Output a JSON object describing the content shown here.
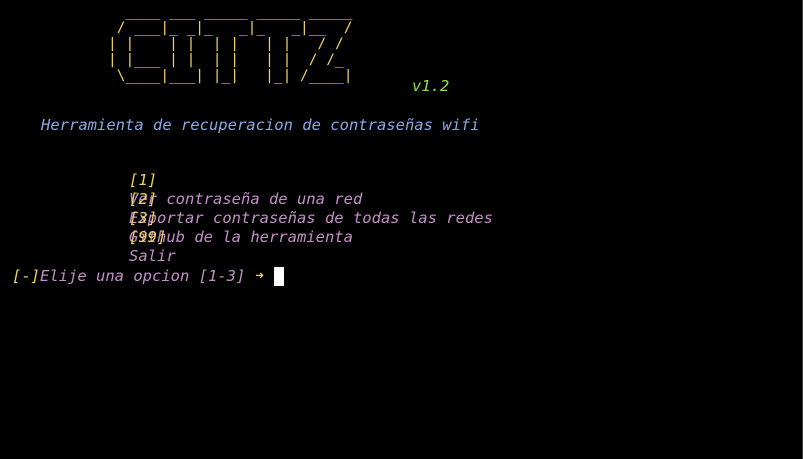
{
  "banner": {
    "ascii_art": "  ____ ___ _____ _____ _____\n / ___|_ _|_   _|_   _|__  /\n| |    | |  | |   | |   / / \n| |___ | |  | |   | |  / /_ \n \\____|___| |_|   |_| /____|",
    "version": "v1.2"
  },
  "subtitle": "Herramienta de recuperacion de contraseñas wifi",
  "menu": [
    {
      "key": "[1]",
      "label": "Ver contraseña de una red"
    },
    {
      "key": "[2]",
      "label": "Exportar contraseñas de todas las redes"
    },
    {
      "key": "[3]",
      "label": "Github de la herramienta"
    },
    {
      "key": "[99]",
      "label": "Salir"
    }
  ],
  "prompt": {
    "marker": "[-]",
    "text": "Elije una opcion [1-3]",
    "arrow": "➜",
    "value": ""
  },
  "colors": {
    "background": "#000000",
    "banner": "#f0d264",
    "version": "#8fe04a",
    "subtitle": "#89a8e6",
    "menu_key": "#f0d264",
    "menu_label": "#c28fc6",
    "cursor": "#ffffff"
  }
}
